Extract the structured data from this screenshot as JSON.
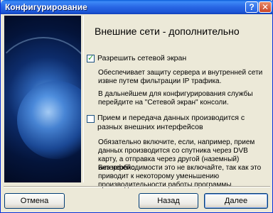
{
  "window": {
    "title": "Конфигурирование"
  },
  "titlebar": {
    "help_label": "?",
    "close_label": "✕"
  },
  "page": {
    "heading": "Внешние сети - дополнительно",
    "option1": {
      "checked": true,
      "label": "Разрешить сетевой экран",
      "desc1": "Обеспечивает защиту сервера и внутренней сети извне путем фильтрации IP трафика.",
      "desc2": "В дальнейшем для конфигурирования службы перейдите на \"Сетевой экран\" консоли."
    },
    "option2": {
      "checked": false,
      "label": "Прием и передача данных производится с разных внешних интерфейсов",
      "desc1": "Обязательно включите, если, например, прием данных производится со спутника через DVB карту, а отправка через другой (наземный) интерфейс.",
      "desc2": "Без необходимости это не включайте, так как это приводит к некоторому уменьшению производительности работы программы."
    }
  },
  "buttons": {
    "cancel": "Отмена",
    "back": "Назад",
    "next": "Далее"
  },
  "check_mark": "✓",
  "icons": {
    "illustration": "globe-network-image"
  }
}
